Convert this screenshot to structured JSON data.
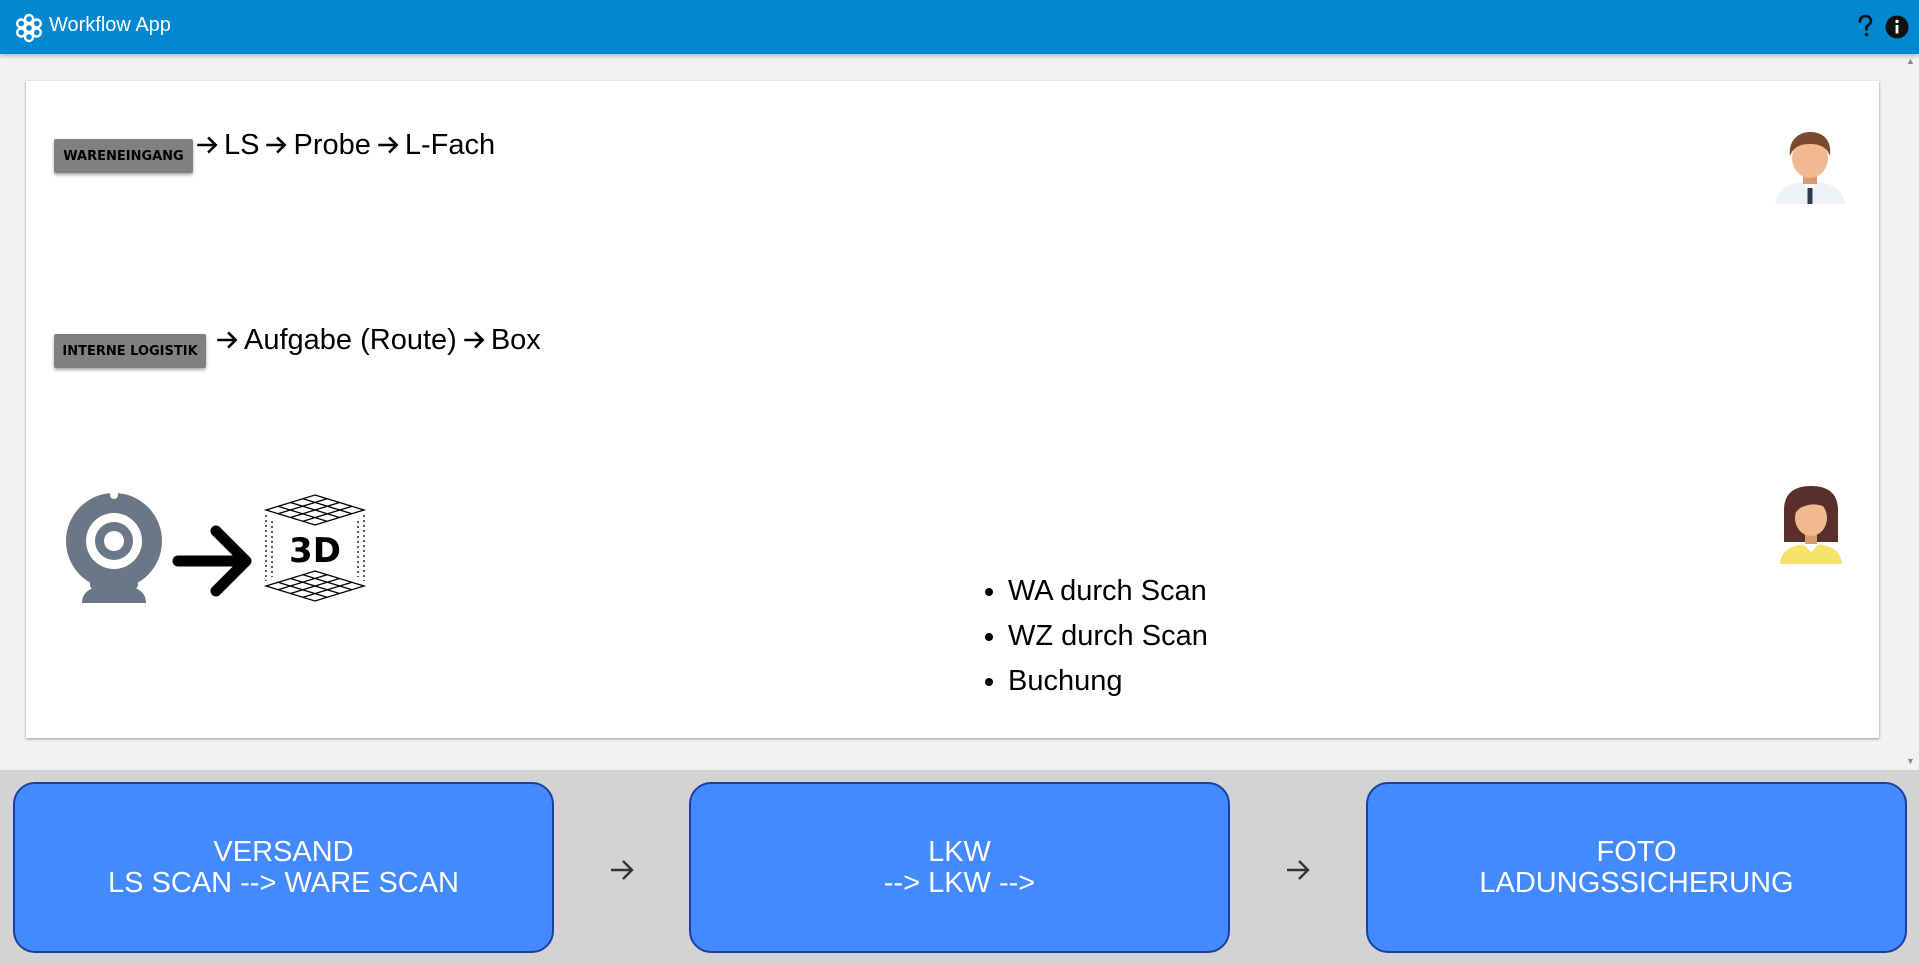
{
  "header": {
    "app_title": "Workflow App",
    "logo_icon": "workflow-flower-icon",
    "help_icon": "question-mark-icon",
    "info_icon": "info-circle-icon",
    "bar_color": "#0288d1"
  },
  "workflow": {
    "step1": {
      "chip_label": "WARENEINGANG",
      "flow": [
        "LS",
        "Probe",
        "L-Fach"
      ],
      "avatar_icon": "businessman-avatar-icon"
    },
    "step2": {
      "chip_label": "INTERNE LOGISTIK",
      "flow": [
        "Aufgabe (Route)",
        "Box"
      ]
    },
    "step3": {
      "camera_icon": "webcam-icon",
      "arrow_icon": "bold-arrow-right-icon",
      "scan_icon": "3d-scan-icon",
      "scan_label": "3D",
      "bullets": [
        "WA durch Scan",
        "WZ durch Scan",
        "Buchung"
      ],
      "avatar_icon": "businesswoman-avatar-icon"
    }
  },
  "actions": {
    "versand": {
      "line1": "VERSAND",
      "line2": "LS SCAN --> WARE SCAN"
    },
    "lkw": {
      "line1": "LKW",
      "line2": "--> LKW -->"
    },
    "foto": {
      "line1": "FOTO",
      "line2": "LADUNGSSICHERUNG"
    },
    "button_color": "#448aff"
  }
}
